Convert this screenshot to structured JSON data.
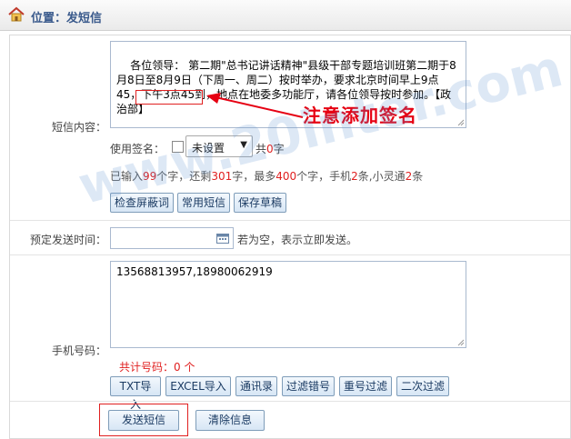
{
  "header": {
    "location_label": "位置",
    "location_separator": "：",
    "location_value": "发短信"
  },
  "form": {
    "content_label": "短信内容：",
    "content_text": "各位领导： 第二期\"总书记讲话精神\"县级干部专题培训班第二期于8月8日至8月9日（下周一、周二）按时举办，要求北京时间早上9点45，下午3点45到，地点在地委多功能厅，请各位领导按时参加。【政治部】",
    "signature_use_label": "使用签名：",
    "signature_selected": "未设置",
    "count_prefix": "共",
    "count_value": "0",
    "count_suffix": "字",
    "input_info_prefix": "已输入",
    "input_info_typed": "99",
    "input_info_mid1": "个字，还剩",
    "input_info_remaining": "301",
    "input_info_mid2": "字，最多",
    "input_info_max": "400",
    "input_info_mid3": "个字，手机",
    "input_info_phone_parts": "2",
    "input_info_mid4": "条,小灵通",
    "input_info_phs_parts": "2",
    "input_info_suffix": "条",
    "btn_check_words": "检查屏蔽词",
    "btn_common_sms": "常用短信",
    "btn_save_draft": "保存草稿",
    "schedule_label": "预定发送时间：",
    "schedule_value": "",
    "schedule_hint": "若为空，表示立即发送。",
    "phone_label": "手机号码：",
    "phone_numbers": "13568813957,18980062919",
    "total_label": "共计号码：",
    "total_value": "0",
    "total_unit": "个",
    "btn_txt_import": "TXT导入",
    "btn_excel_import": "EXCEL导入",
    "btn_contacts": "通讯录",
    "btn_filter_wrong": "过滤错号",
    "btn_dedupe": "重号过滤",
    "btn_second_filter": "二次过滤",
    "btn_send": "发送短信",
    "btn_clear": "清除信息"
  },
  "annotation": {
    "text": "注意添加签名"
  },
  "watermark": {
    "text": "www.20inter.com"
  },
  "colors": {
    "accent_red": "#e02020",
    "button_border": "#7f9db9",
    "header_text": "#3a5a8c"
  }
}
